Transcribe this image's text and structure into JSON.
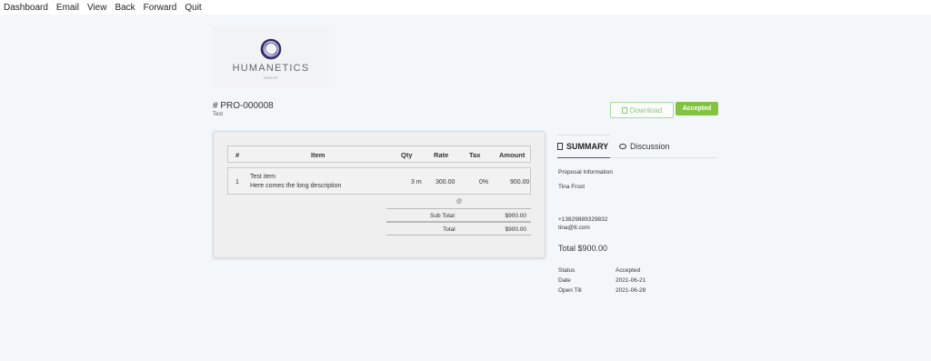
{
  "menu": [
    "Dashboard",
    "Email",
    "View",
    "Back",
    "Forward",
    "Quit"
  ],
  "logo": {
    "name": "HUMANETICS",
    "sub": "GROUP"
  },
  "proposal": {
    "number": "# PRO-000008",
    "subject": "Test"
  },
  "actions": {
    "download_label": "Download",
    "status_label": "Accepted",
    "accent": "#84c341"
  },
  "table": {
    "headers": {
      "num": "#",
      "item": "Item",
      "qty": "Qty",
      "rate": "Rate",
      "tax": "Tax",
      "amount": "Amount"
    },
    "rows": [
      {
        "num": "1",
        "item": "Test item",
        "description": "Here comes the long description",
        "qty": "3 m",
        "rate": "300.00",
        "tax": "0%",
        "amount": "900.00"
      }
    ],
    "marker": "@",
    "subtotal_label": "Sub Total",
    "subtotal_value": "$900.00",
    "total_label": "Total",
    "total_value": "$900.00"
  },
  "tabs": {
    "summary": "SUMMARY",
    "discussion": "Discussion"
  },
  "summary": {
    "section_title": "Proposal Information",
    "client_name": "Tina Frost",
    "phone": "+13829889329832",
    "email": "tina@tt.com",
    "total": "Total $900.00",
    "status_label": "Status",
    "status_value": "Accepted",
    "date_label": "Date",
    "date_value": "2021-06-21",
    "open_till_label": "Open Till",
    "open_till_value": "2021-06-28"
  }
}
